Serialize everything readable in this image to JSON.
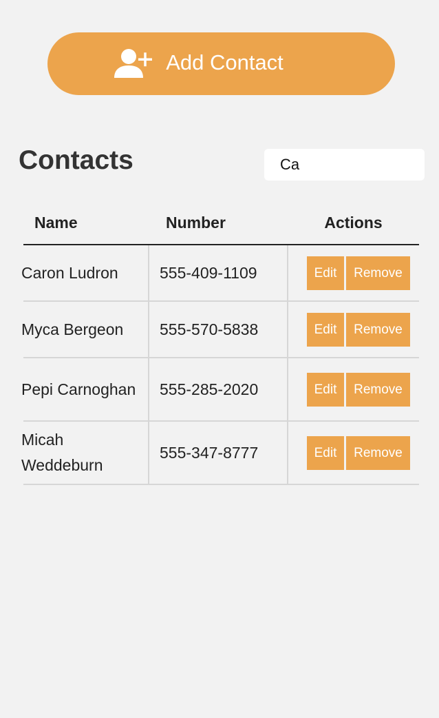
{
  "add_button": {
    "label": "Add Contact",
    "icon": "add-user-icon"
  },
  "contacts": {
    "title": "Contacts",
    "search_value": "Ca"
  },
  "table": {
    "headers": {
      "name": "Name",
      "number": "Number",
      "actions": "Actions"
    },
    "rows": [
      {
        "name": "Caron Ludron",
        "number": "555-409-1109",
        "edit": "Edit",
        "remove": "Remove"
      },
      {
        "name": "Myca Bergeon",
        "number": "555-570-5838",
        "edit": "Edit",
        "remove": "Remove"
      },
      {
        "name": "Pepi Carnoghan",
        "number": "555-285-2020",
        "edit": "Edit",
        "remove": "Remove"
      },
      {
        "name": "Micah Weddeburn",
        "number": "555-347-8777",
        "edit": "Edit",
        "remove": "Remove"
      }
    ]
  },
  "colors": {
    "accent": "#eca44c",
    "background": "#f2f2f2"
  }
}
